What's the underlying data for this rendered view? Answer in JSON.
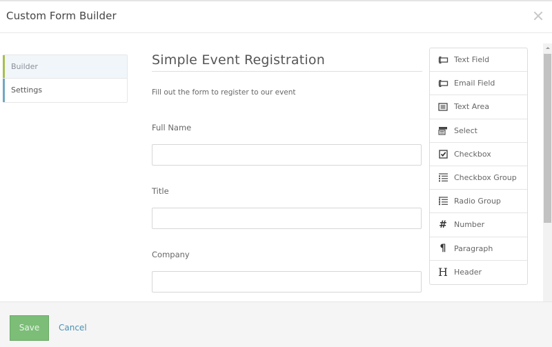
{
  "header": {
    "title": "Custom Form Builder",
    "close_icon": "close-icon"
  },
  "nav": {
    "items": [
      {
        "label": "Builder",
        "active": true
      },
      {
        "label": "Settings",
        "active": false
      }
    ]
  },
  "form": {
    "title": "Simple Event Registration",
    "description": "Fill out the form to register to our event",
    "fields": [
      {
        "label": "Full Name",
        "value": "",
        "placeholder": ""
      },
      {
        "label": "Title",
        "value": "",
        "placeholder": ""
      },
      {
        "label": "Company",
        "value": "",
        "placeholder": ""
      }
    ]
  },
  "palette": {
    "items": [
      {
        "label": "Text Field",
        "icon": "text-field-icon"
      },
      {
        "label": "Email Field",
        "icon": "email-field-icon"
      },
      {
        "label": "Text Area",
        "icon": "text-area-icon"
      },
      {
        "label": "Select",
        "icon": "select-icon"
      },
      {
        "label": "Checkbox",
        "icon": "checkbox-icon"
      },
      {
        "label": "Checkbox Group",
        "icon": "checkbox-group-icon"
      },
      {
        "label": "Radio Group",
        "icon": "radio-group-icon"
      },
      {
        "label": "Number",
        "icon": "number-icon",
        "glyph": "#"
      },
      {
        "label": "Paragraph",
        "icon": "paragraph-icon",
        "glyph": "¶"
      },
      {
        "label": "Header",
        "icon": "header-icon",
        "glyph": "H"
      }
    ]
  },
  "footer": {
    "save_label": "Save",
    "cancel_label": "Cancel"
  },
  "colors": {
    "save_button": "#7cbd78",
    "cancel_link": "#4a8fb4",
    "builder_accent": "#a7bf4d",
    "settings_accent": "#6fa8c0"
  }
}
